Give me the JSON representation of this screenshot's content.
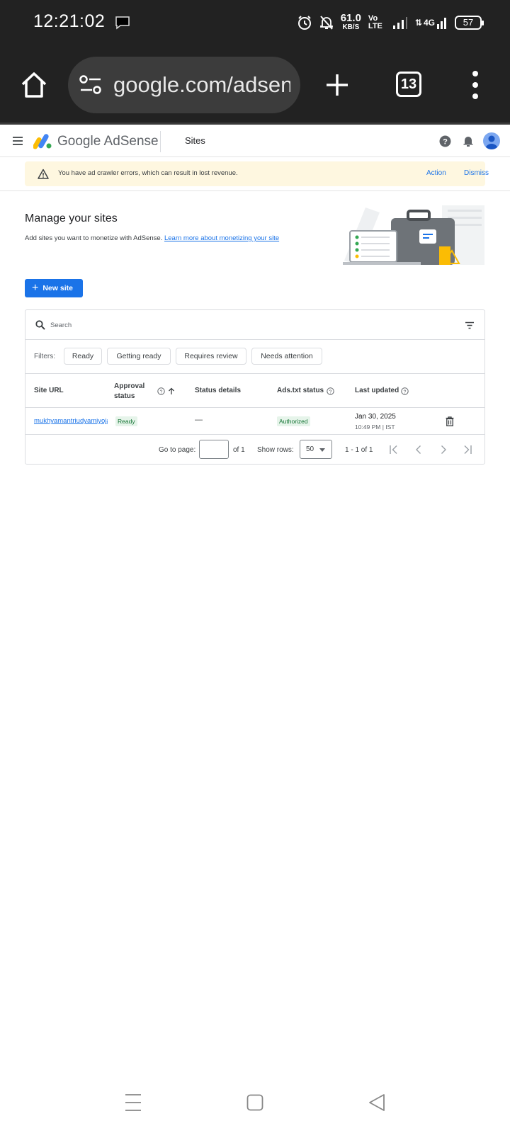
{
  "status_bar": {
    "time": "12:21:02",
    "net_speed": "61.0",
    "net_unit": "KB/S",
    "volte": "Vo LTE",
    "network": "4G",
    "battery": "57"
  },
  "browser": {
    "url": "google.com/adsense",
    "tab_count": "13"
  },
  "header": {
    "brand_google": "Google",
    "brand_product": "AdSense",
    "section": "Sites"
  },
  "alert": {
    "message": "You have ad crawler errors, which can result in lost revenue.",
    "action_label": "Action",
    "dismiss_label": "Dismiss"
  },
  "page": {
    "title": "Manage your sites",
    "description": "Add sites you want to monetize with AdSense. ",
    "learn_more": "Learn more about monetizing your site",
    "new_site_label": "New site"
  },
  "search": {
    "placeholder": "Search"
  },
  "filters": {
    "label": "Filters:",
    "chips": [
      "Ready",
      "Getting ready",
      "Requires review",
      "Needs attention"
    ]
  },
  "table": {
    "columns": [
      "Site URL",
      "Approval status",
      "Status details",
      "Ads.txt status",
      "Last updated"
    ],
    "rows": [
      {
        "site_url": "mukhyamantriudyamiyojana.com",
        "approval": "Ready",
        "details": "—",
        "ads_txt": "Authorized",
        "updated_date": "Jan 30, 2025",
        "updated_time": "10:49 PM | IST"
      }
    ]
  },
  "pager": {
    "go_to_page": "Go to page:",
    "of_pages": "of 1",
    "show_rows": "Show rows:",
    "rows_value": "50",
    "range": "1 - 1 of 1"
  },
  "colors": {
    "accent": "#1a73e8",
    "alert_bg": "#fef7e0",
    "success_bg": "#e6f4ea",
    "success_text": "#137333",
    "chrome_dark": "#222222"
  }
}
